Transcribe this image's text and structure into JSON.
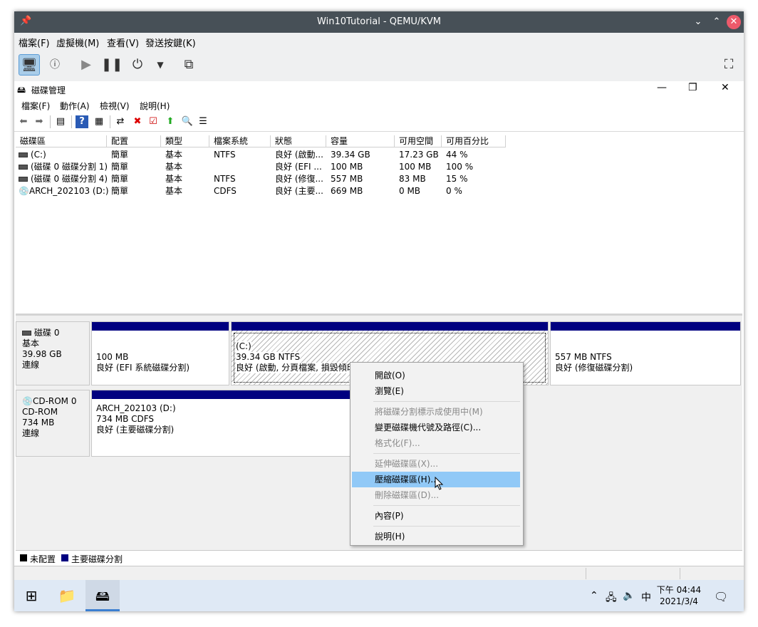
{
  "kde": {
    "title": "Win10Tutorial - QEMU/KVM"
  },
  "qemu_menu": [
    "檔案(F)",
    "虛擬機(M)",
    "查看(V)",
    "發送按鍵(K)"
  ],
  "app": {
    "title": "磁碟管理"
  },
  "app_menu": [
    "檔案(F)",
    "動作(A)",
    "檢視(V)",
    "說明(H)"
  ],
  "columns": [
    "磁碟區",
    "配置",
    "類型",
    "檔案系統",
    "狀態",
    "容量",
    "可用空間",
    "可用百分比"
  ],
  "volumes": [
    [
      "(C:)",
      "簡單",
      "基本",
      "NTFS",
      "良好 (啟動...",
      "39.34 GB",
      "17.23 GB",
      "44 %"
    ],
    [
      "(磁碟 0 磁碟分割 1)",
      "簡單",
      "基本",
      "",
      "良好 (EFI ...",
      "100 MB",
      "100 MB",
      "100 %"
    ],
    [
      "(磁碟 0 磁碟分割 4)",
      "簡單",
      "基本",
      "NTFS",
      "良好 (修復...",
      "557 MB",
      "83 MB",
      "15 %"
    ],
    [
      "ARCH_202103 (D:)",
      "簡單",
      "基本",
      "CDFS",
      "良好 (主要...",
      "669 MB",
      "0 MB",
      "0 %"
    ]
  ],
  "disk0": {
    "name": "磁碟 0",
    "type": "基本",
    "size": "39.98 GB",
    "status": "連線",
    "p1": {
      "size": "100 MB",
      "status": "良好 (EFI 系統磁碟分割)"
    },
    "p2": {
      "name": "(C:)",
      "size": "39.34 GB NTFS",
      "status": "良好 (啟動, 分頁檔案, 損毀傾印, 基本資料磁碟分割)"
    },
    "p3": {
      "size": "557 MB NTFS",
      "status": "良好 (修復磁碟分割)"
    }
  },
  "cdrom0": {
    "name": "CD-ROM 0",
    "type": "CD-ROM",
    "size": "734 MB",
    "status": "連線",
    "p1": {
      "name": "ARCH_202103  (D:)",
      "size": "734 MB CDFS",
      "status": "良好 (主要磁碟分割)"
    }
  },
  "legend": {
    "unallocated": "未配置",
    "primary": "主要磁碟分割",
    "unallocated_color": "#000000",
    "primary_color": "#000080"
  },
  "context_menu": {
    "open": "開啟(O)",
    "explore": "瀏覽(E)",
    "mark_active": "將磁碟分割標示成使用中(M)",
    "change_letter": "變更磁碟機代號及路徑(C)...",
    "format": "格式化(F)...",
    "extend": "延伸磁碟區(X)...",
    "shrink": "壓縮磁碟區(H)...",
    "delete": "刪除磁碟區(D)...",
    "properties": "內容(P)",
    "help": "說明(H)"
  },
  "taskbar": {
    "time": "下午 04:44",
    "date": "2021/3/4",
    "ime": "中"
  }
}
